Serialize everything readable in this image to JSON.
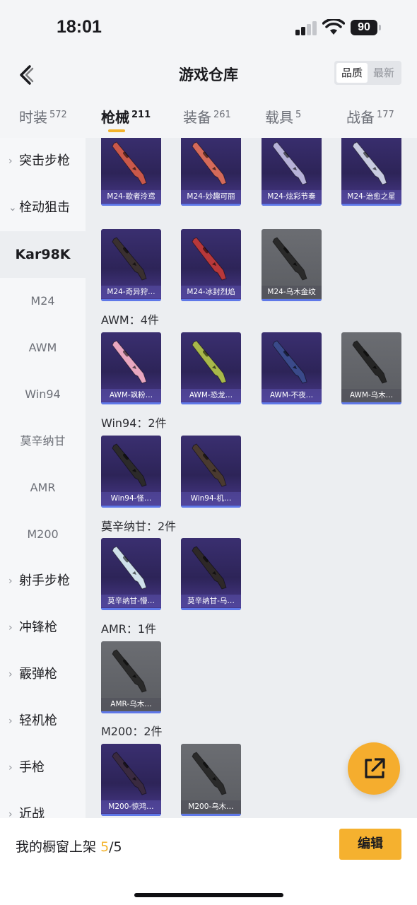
{
  "status_bar": {
    "time": "18:01",
    "battery": "90"
  },
  "header": {
    "title": "游戏仓库",
    "sort_quality": "品质",
    "sort_latest": "最新"
  },
  "tabs": [
    {
      "label": "时装",
      "count": "572"
    },
    {
      "label": "枪械",
      "count": "211"
    },
    {
      "label": "装备",
      "count": "261"
    },
    {
      "label": "载具",
      "count": "5"
    },
    {
      "label": "战备",
      "count": "177"
    }
  ],
  "sidebar": {
    "cat_assault": "突击步枪",
    "cat_bolt": "栓动狙击",
    "sub_kar98k": "Kar98K",
    "sub_m24": "M24",
    "sub_awm": "AWM",
    "sub_win94": "Win94",
    "sub_mosin": "莫辛纳甘",
    "sub_amr": "AMR",
    "sub_m200": "M200",
    "cat_dmr": "射手步枪",
    "cat_smg": "冲锋枪",
    "cat_shotgun": "霰弹枪",
    "cat_lmg": "轻机枪",
    "cat_pistol": "手枪",
    "cat_melee": "近战"
  },
  "groups": {
    "awm": "AWM：4件",
    "win94": "Win94：2件",
    "mosin": "莫辛纳甘：2件",
    "amr": "AMR：1件",
    "m200": "M200：2件"
  },
  "items": {
    "m24_1": "M24-歌者泠鸢",
    "m24_2": "M24-妙趣可丽",
    "m24_3": "M24-炫彩节奏",
    "m24_4": "M24-治愈之星",
    "m24_5": "M24-奇异狩…",
    "m24_6": "M24-冰封烈焰",
    "m24_7": "M24-乌木金纹",
    "awm_1": "AWM-飒粉…",
    "awm_2": "AWM-恐龙…",
    "awm_3": "AWM-不夜…",
    "awm_4": "AWM-乌木…",
    "win_1": "Win94-怪…",
    "win_2": "Win94-机…",
    "mosin_1": "莫辛纳甘-懵…",
    "mosin_2": "莫辛纳甘-乌…",
    "amr_1": "AMR-乌木…",
    "m200_1": "M200-惊鸿…",
    "m200_2": "M200-乌木…"
  },
  "bottom": {
    "showcase_label": "我的橱窗上架",
    "showcase_count": "5",
    "showcase_total": "/5",
    "edit_label": "编辑"
  },
  "colors": {
    "accent": "#f3b32c",
    "card_purple": "#2d2458",
    "card_grey": "#5a5c61"
  }
}
